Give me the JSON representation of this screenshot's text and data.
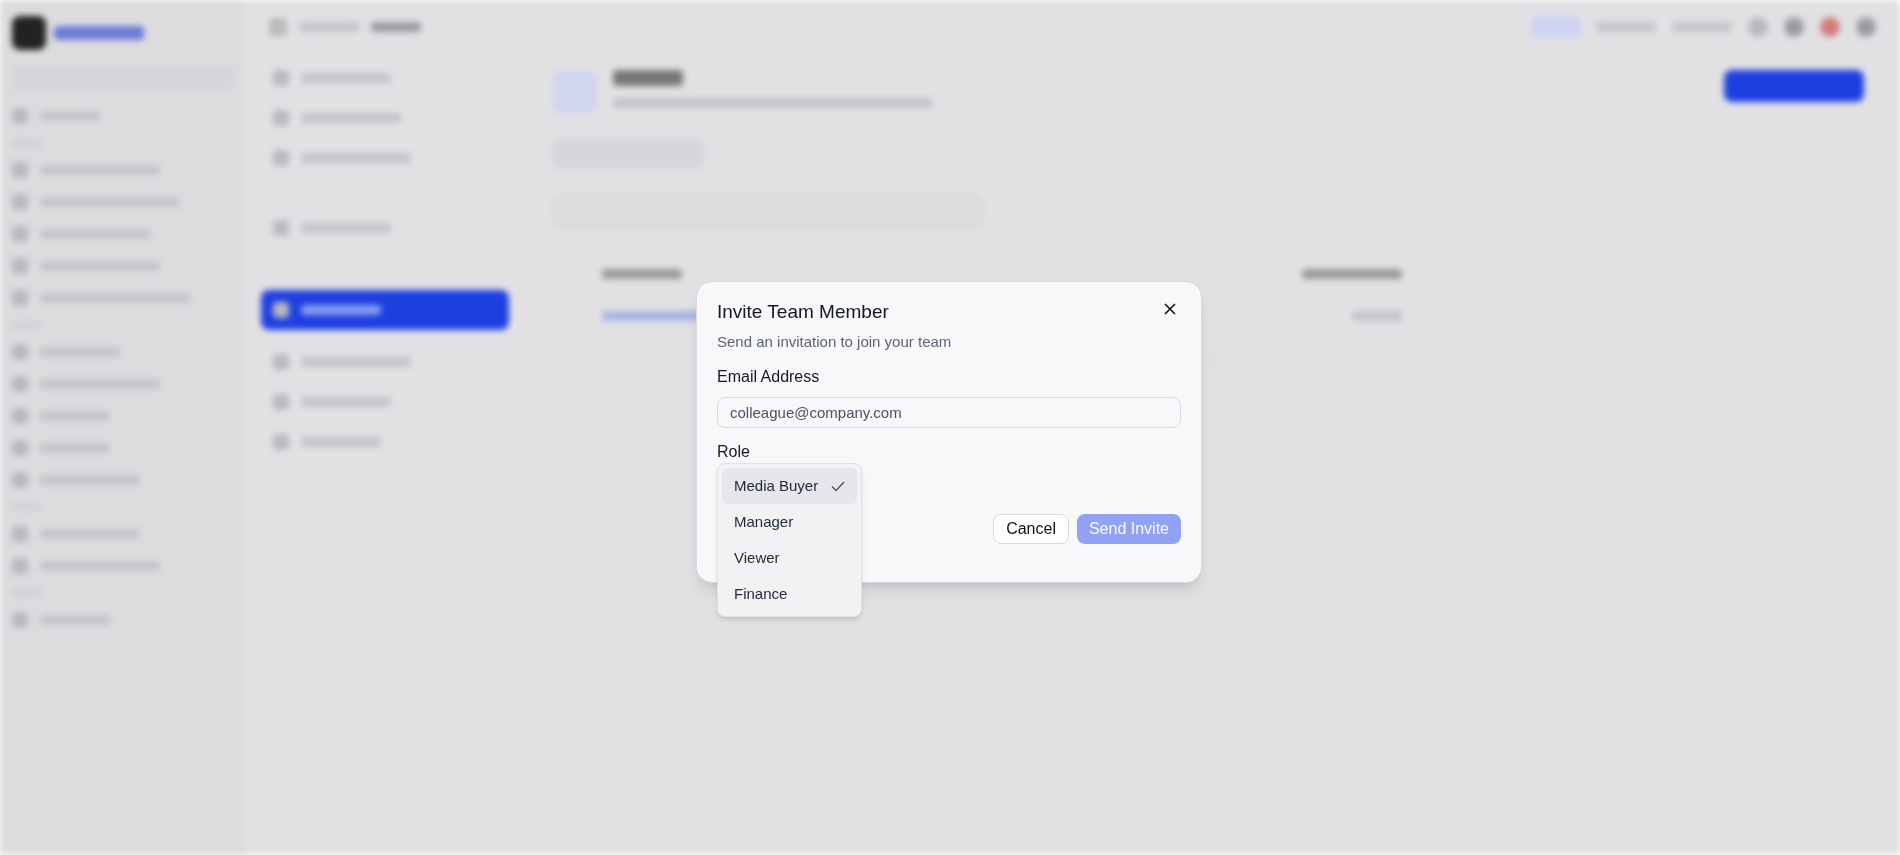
{
  "dialog": {
    "title": "Invite Team Member",
    "subtitle": "Send an invitation to join your team",
    "email_label": "Email Address",
    "email_placeholder": "colleague@company.com",
    "role_label": "Role",
    "role_options": [
      {
        "label": "Media Buyer",
        "selected": true
      },
      {
        "label": "Manager",
        "selected": false
      },
      {
        "label": "Viewer",
        "selected": false
      },
      {
        "label": "Finance",
        "selected": false
      }
    ],
    "buttons": [
      {
        "label": "Cancel",
        "kind": "secondary",
        "disabled": false
      },
      {
        "label": "Send Invite",
        "kind": "primary",
        "disabled": true
      }
    ]
  }
}
